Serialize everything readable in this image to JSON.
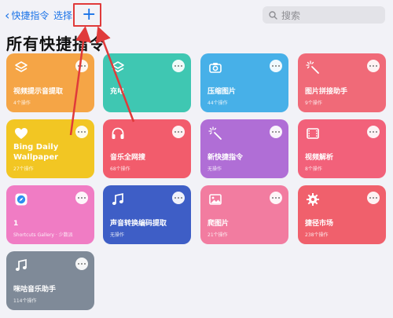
{
  "nav": {
    "back_label": "快捷指令",
    "select_label": "选择",
    "add_label": "+",
    "search_placeholder": "搜索"
  },
  "page_title": "所有快捷指令",
  "cards": [
    {
      "name": "视频提示音提取",
      "sub": "4个操作",
      "color": "#f5a546",
      "icon": "layers-icon"
    },
    {
      "name": "充电",
      "sub": "",
      "color": "#3fc7b2",
      "icon": "layers-icon"
    },
    {
      "name": "压缩图片",
      "sub": "44个操作",
      "color": "#47b0e8",
      "icon": "camera-icon"
    },
    {
      "name": "图片拼接助手",
      "sub": "9个操作",
      "color": "#f06a78",
      "icon": "magic-wand-icon"
    },
    {
      "name": "Bing Daily Wallpaper",
      "sub": "27个操作",
      "color": "#f2c623",
      "icon": "heart-icon"
    },
    {
      "name": "音乐全网搜",
      "sub": "68个操作",
      "color": "#f25c6c",
      "icon": "headphones-icon"
    },
    {
      "name": "新快捷指令",
      "sub": "无操作",
      "color": "#b06ed6",
      "icon": "magic-wand-icon"
    },
    {
      "name": "视频解析",
      "sub": "8个操作",
      "color": "#f2617a",
      "icon": "film-icon"
    },
    {
      "name": "1",
      "sub": "Shortcuts Gallery · 少数派",
      "color": "#f07cc4",
      "icon": "safari-icon"
    },
    {
      "name": "声音转换编码提取",
      "sub": "无操作",
      "color": "#3e5ec6",
      "icon": "music-note-icon"
    },
    {
      "name": "爬图片",
      "sub": "21个操作",
      "color": "#f27ca0",
      "icon": "photo-icon"
    },
    {
      "name": "捷径市场",
      "sub": "238个操作",
      "color": "#f0606c",
      "icon": "gear-icon"
    },
    {
      "name": "咪咕音乐助手",
      "sub": "114个操作",
      "color": "#7f8a98",
      "icon": "music-note-icon"
    }
  ],
  "annotation": {
    "color": "#e03a3a"
  }
}
